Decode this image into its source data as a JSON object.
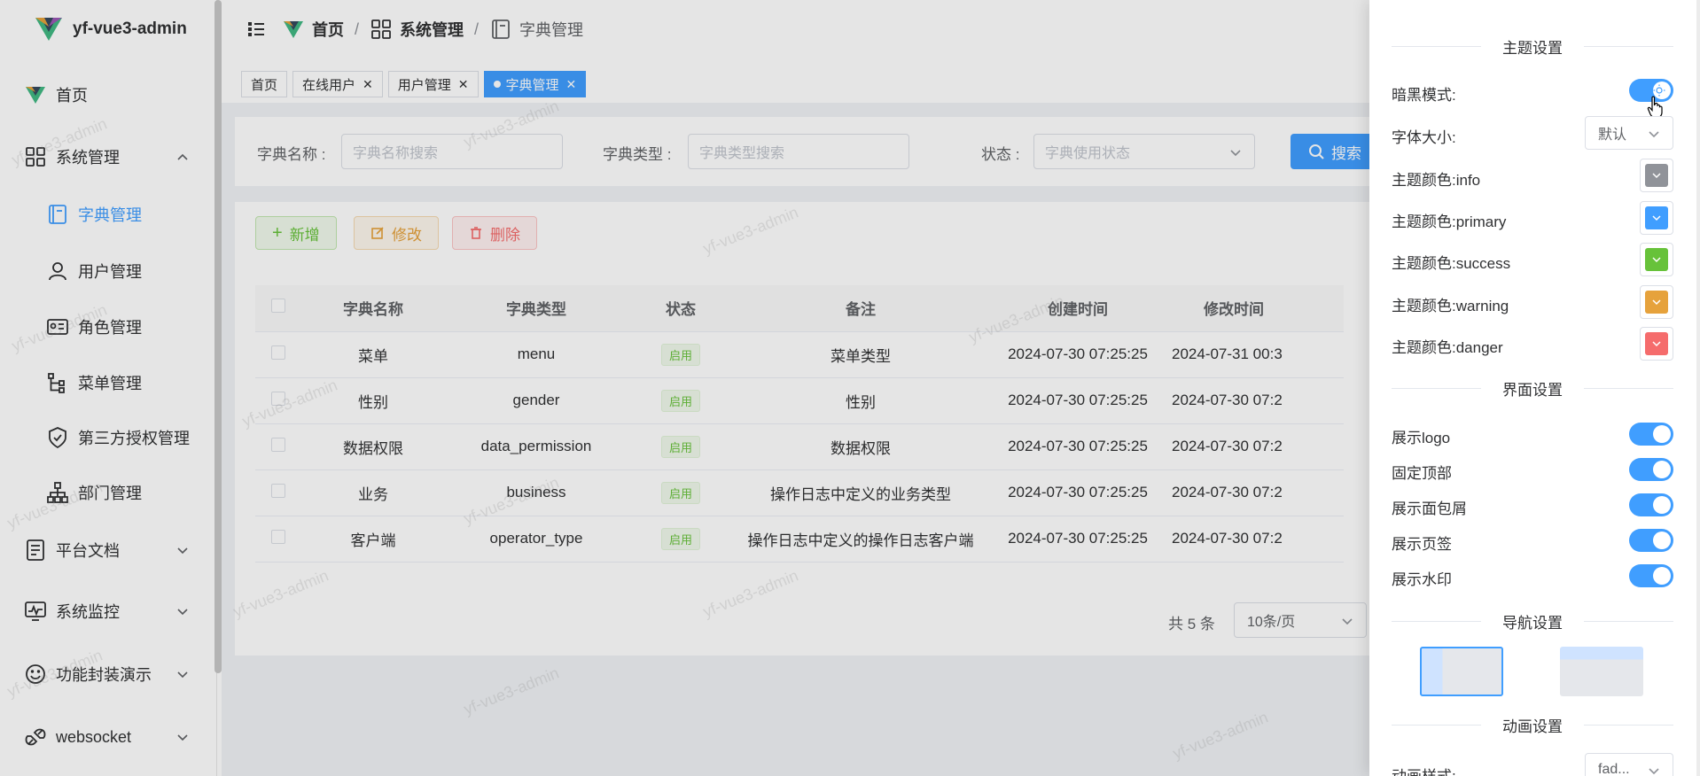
{
  "app": {
    "title": "yf-vue3-admin",
    "watermark": "yf-vue3-admin"
  },
  "sidebar": {
    "items": [
      {
        "label": "首页"
      },
      {
        "label": "系统管理"
      },
      {
        "label": "字典管理"
      },
      {
        "label": "用户管理"
      },
      {
        "label": "角色管理"
      },
      {
        "label": "菜单管理"
      },
      {
        "label": "第三方授权管理"
      },
      {
        "label": "部门管理"
      },
      {
        "label": "平台文档"
      },
      {
        "label": "系统监控"
      },
      {
        "label": "功能封装演示"
      },
      {
        "label": "websocket"
      }
    ]
  },
  "breadcrumb": {
    "items": [
      "首页",
      "系统管理",
      "字典管理"
    ],
    "separator": "/"
  },
  "tabs": [
    {
      "label": "首页"
    },
    {
      "label": "在线用户"
    },
    {
      "label": "用户管理"
    },
    {
      "label": "字典管理"
    }
  ],
  "search": {
    "name_label": "字典名称 :",
    "name_placeholder": "字典名称搜索",
    "type_label": "字典类型 :",
    "type_placeholder": "字典类型搜索",
    "status_label": "状态 :",
    "status_placeholder": "字典使用状态",
    "search_button": "搜索"
  },
  "toolbar": {
    "add": "新增",
    "edit": "修改",
    "delete": "删除"
  },
  "table": {
    "headers": [
      "字典名称",
      "字典类型",
      "状态",
      "备注",
      "创建时间",
      "修改时间"
    ],
    "rows": [
      [
        "菜单",
        "menu",
        "启用",
        "菜单类型",
        "2024-07-30 07:25:25",
        "2024-07-31 00:3"
      ],
      [
        "性别",
        "gender",
        "启用",
        "性别",
        "2024-07-30 07:25:25",
        "2024-07-30 07:2"
      ],
      [
        "数据权限",
        "data_permission",
        "启用",
        "数据权限",
        "2024-07-30 07:25:25",
        "2024-07-30 07:2"
      ],
      [
        "业务",
        "business",
        "启用",
        "操作日志中定义的业务类型",
        "2024-07-30 07:25:25",
        "2024-07-30 07:2"
      ],
      [
        "客户端",
        "operator_type",
        "启用",
        "操作日志中定义的操作日志客户端",
        "2024-07-30 07:25:25",
        "2024-07-30 07:2"
      ]
    ]
  },
  "pagination": {
    "total": "共 5 条",
    "page_size": "10条/页"
  },
  "drawer": {
    "theme_section": "主题设置",
    "dark_mode": "暗黑模式:",
    "font_size": "字体大小:",
    "font_size_value": "默认",
    "colors": [
      {
        "label": "主题颜色:info",
        "color": "#909399"
      },
      {
        "label": "主题颜色:primary",
        "color": "#409eff"
      },
      {
        "label": "主题颜色:success",
        "color": "#67c23a"
      },
      {
        "label": "主题颜色:warning",
        "color": "#e6a23c"
      },
      {
        "label": "主题颜色:danger",
        "color": "#f56c6c"
      }
    ],
    "ui_section": "界面设置",
    "toggles": [
      {
        "label": "展示logo"
      },
      {
        "label": "固定顶部"
      },
      {
        "label": "展示面包屑"
      },
      {
        "label": "展示页签"
      },
      {
        "label": "展示水印"
      }
    ],
    "nav_section": "导航设置",
    "anim_section": "动画设置",
    "anim_label": "动画样式:",
    "anim_value": "fad..."
  },
  "accent": "#409eff"
}
